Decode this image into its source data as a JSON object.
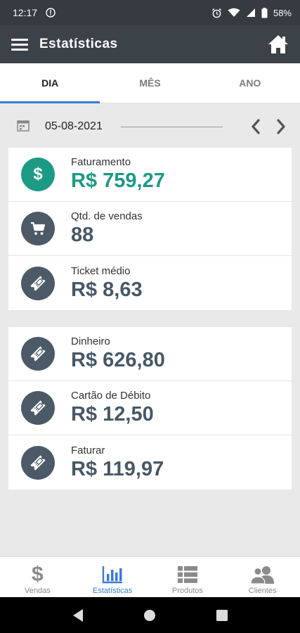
{
  "status": {
    "time": "12:17",
    "battery": "58%"
  },
  "appbar": {
    "title": "Estatísticas"
  },
  "tabs": [
    {
      "label": "DIA",
      "active": true
    },
    {
      "label": "MÊS",
      "active": false
    },
    {
      "label": "ANO",
      "active": false
    }
  ],
  "date": {
    "value": "05-08-2021"
  },
  "summary": [
    {
      "label": "Faturamento",
      "value": "R$ 759,27",
      "icon": "dollar-icon"
    },
    {
      "label": "Qtd. de vendas",
      "value": "88",
      "icon": "cart-icon"
    },
    {
      "label": "Ticket médio",
      "value": "R$ 8,63",
      "icon": "ticket-icon"
    }
  ],
  "payments": [
    {
      "label": "Dinheiro",
      "value": "R$ 626,80",
      "icon": "ticket-icon"
    },
    {
      "label": "Cartão de Débito",
      "value": "R$ 12,50",
      "icon": "ticket-icon"
    },
    {
      "label": "Faturar",
      "value": "R$ 119,97",
      "icon": "ticket-icon"
    }
  ],
  "bottomnav": [
    {
      "label": "Vendas",
      "icon": "dollar-sign-icon"
    },
    {
      "label": "Estatísticas",
      "icon": "bar-chart-icon",
      "active": true
    },
    {
      "label": "Produtos",
      "icon": "list-icon"
    },
    {
      "label": "Clientes",
      "icon": "users-icon"
    }
  ],
  "colors": {
    "accent": "#3a7bd5",
    "teal": "#1d9a84",
    "slate": "#475867",
    "appbar": "#3b4248"
  }
}
